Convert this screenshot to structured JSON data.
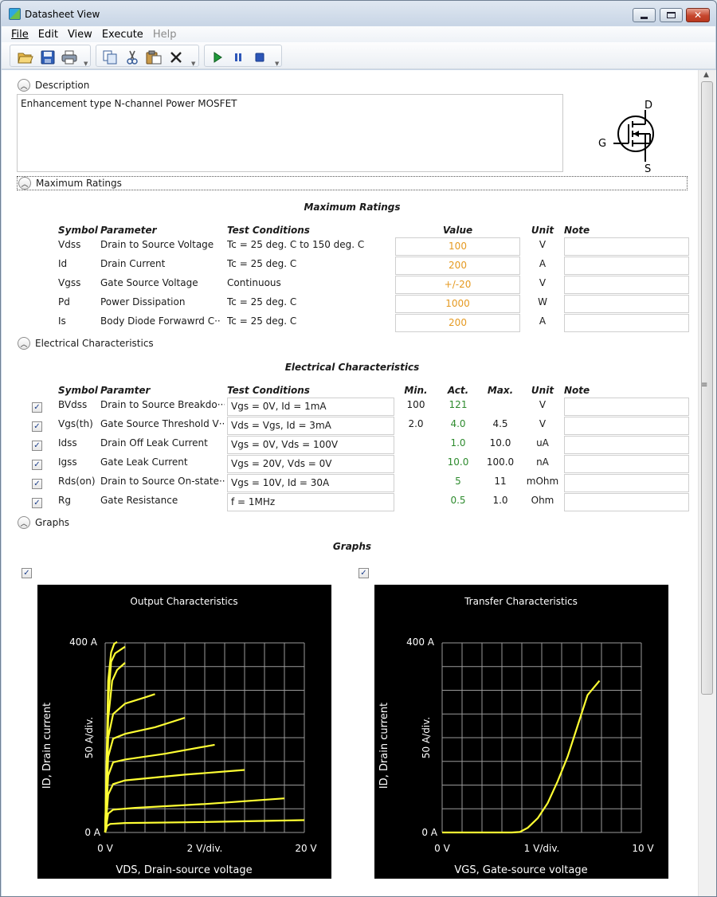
{
  "window": {
    "title": "Datasheet View"
  },
  "menu": {
    "items": [
      "File",
      "Edit",
      "View",
      "Execute",
      "Help"
    ]
  },
  "description": {
    "label": "Description",
    "text": "Enhancement type N-channel Power MOSFET",
    "symbol": {
      "d": "D",
      "g": "G",
      "s": "S"
    }
  },
  "max_ratings": {
    "label": "Maximum Ratings",
    "title": "Maximum Ratings",
    "headers": {
      "symbol": "Symbol",
      "parameter": "Parameter",
      "conditions": "Test Conditions",
      "value": "Value",
      "unit": "Unit",
      "note": "Note"
    },
    "rows": [
      {
        "symbol": "Vdss",
        "parameter": "Drain to Source Voltage",
        "conditions": "Tc = 25 deg. C to 150 deg. C",
        "value": "100",
        "unit": "V",
        "note": ""
      },
      {
        "symbol": "Id",
        "parameter": "Drain Current",
        "conditions": "Tc = 25 deg. C",
        "value": "200",
        "unit": "A",
        "note": ""
      },
      {
        "symbol": "Vgss",
        "parameter": "Gate Source Voltage",
        "conditions": "Continuous",
        "value": "+/-20",
        "unit": "V",
        "note": ""
      },
      {
        "symbol": "Pd",
        "parameter": "Power Dissipation",
        "conditions": "Tc = 25 deg. C",
        "value": "1000",
        "unit": "W",
        "note": ""
      },
      {
        "symbol": "Is",
        "parameter": "Body Diode Forwawrd C···",
        "conditions": "Tc = 25 deg. C",
        "value": "200",
        "unit": "A",
        "note": ""
      }
    ]
  },
  "electrical": {
    "label": "Electrical Characteristics",
    "title": "Electrical Characteristics",
    "headers": {
      "symbol": "Symbol",
      "parameter": "Paramter",
      "conditions": "Test Conditions",
      "min": "Min.",
      "act": "Act.",
      "max": "Max.",
      "unit": "Unit",
      "note": "Note"
    },
    "rows": [
      {
        "checked": true,
        "symbol": "BVdss",
        "parameter": "Drain to Source Breakdo···",
        "conditions": "Vgs = 0V, Id = 1mA",
        "min": "100",
        "act": "121",
        "max": "",
        "unit": "V",
        "note": ""
      },
      {
        "checked": true,
        "symbol": "Vgs(th)",
        "parameter": "Gate Source Threshold V···",
        "conditions": "Vds = Vgs, Id = 3mA",
        "min": "2.0",
        "act": "4.0",
        "max": "4.5",
        "unit": "V",
        "note": ""
      },
      {
        "checked": true,
        "symbol": "Idss",
        "parameter": "Drain Off Leak Current",
        "conditions": "Vgs = 0V, Vds = 100V",
        "min": "",
        "act": "1.0",
        "max": "10.0",
        "unit": "uA",
        "note": ""
      },
      {
        "checked": true,
        "symbol": "Igss",
        "parameter": "Gate Leak Current",
        "conditions": "Vgs = 20V, Vds = 0V",
        "min": "",
        "act": "10.0",
        "max": "100.0",
        "unit": "nA",
        "note": ""
      },
      {
        "checked": true,
        "symbol": "Rds(on)",
        "parameter": "Drain to Source On-state···",
        "conditions": "Vgs = 10V, Id = 30A",
        "min": "",
        "act": "5",
        "max": "11",
        "unit": "mOhm",
        "note": ""
      },
      {
        "checked": true,
        "symbol": "Rg",
        "parameter": "Gate Resistance",
        "conditions": "f = 1MHz",
        "min": "",
        "act": "0.5",
        "max": "1.0",
        "unit": "Ohm",
        "note": ""
      }
    ]
  },
  "graphs": {
    "label": "Graphs",
    "title": "Graphs"
  },
  "chart_data": [
    {
      "type": "line",
      "title": "Output Characteristics",
      "xlabel": "VDS, Drain-source voltage",
      "ylabel": "ID, Drain current",
      "x_ticks": [
        "0 V",
        "2 V/div.",
        "20 V"
      ],
      "y_ticks": [
        "0 A",
        "50 A/div.",
        "400 A"
      ],
      "xlim": [
        0,
        20
      ],
      "ylim": [
        0,
        400
      ],
      "grid": true,
      "line_color": "#ffff33",
      "series": [
        {
          "values": [
            [
              0,
              0
            ],
            [
              0.2,
              14
            ],
            [
              0.5,
              18
            ],
            [
              2,
              20
            ],
            [
              10,
              22
            ],
            [
              20,
              26
            ]
          ]
        },
        {
          "values": [
            [
              0,
              0
            ],
            [
              0.3,
              40
            ],
            [
              0.8,
              48
            ],
            [
              3,
              52
            ],
            [
              10,
              60
            ],
            [
              18,
              72
            ]
          ]
        },
        {
          "values": [
            [
              0,
              0
            ],
            [
              0.3,
              80
            ],
            [
              0.8,
              102
            ],
            [
              2,
              110
            ],
            [
              8,
              122
            ],
            [
              14,
              132
            ]
          ]
        },
        {
          "values": [
            [
              0,
              0
            ],
            [
              0.3,
              120
            ],
            [
              0.8,
              148
            ],
            [
              2,
              154
            ],
            [
              6,
              166
            ],
            [
              11,
              185
            ]
          ]
        },
        {
          "values": [
            [
              0,
              0
            ],
            [
              0.3,
              160
            ],
            [
              0.8,
              198
            ],
            [
              2,
              208
            ],
            [
              5,
              222
            ],
            [
              8,
              242
            ]
          ]
        },
        {
          "values": [
            [
              0,
              0
            ],
            [
              0.3,
              200
            ],
            [
              0.8,
              250
            ],
            [
              2,
              272
            ],
            [
              4,
              285
            ],
            [
              5,
              292
            ]
          ]
        },
        {
          "values": [
            [
              0,
              0
            ],
            [
              0.3,
              240
            ],
            [
              0.7,
              320
            ],
            [
              1.2,
              343
            ],
            [
              2,
              358
            ]
          ]
        },
        {
          "values": [
            [
              0,
              0
            ],
            [
              0.3,
              280
            ],
            [
              0.6,
              360
            ],
            [
              1,
              378
            ],
            [
              2,
              392
            ]
          ]
        },
        {
          "values": [
            [
              0,
              0
            ],
            [
              0.3,
              320
            ],
            [
              0.6,
              380
            ],
            [
              0.9,
              398
            ],
            [
              1.2,
              402
            ]
          ]
        }
      ]
    },
    {
      "type": "line",
      "title": "Transfer Characteristics",
      "xlabel": "VGS, Gate-source voltage",
      "ylabel": "ID, Drain current",
      "x_ticks": [
        "0 V",
        "1 V/div.",
        "10 V"
      ],
      "y_ticks": [
        "0 A",
        "50 A/div.",
        "400 A"
      ],
      "xlim": [
        0,
        10
      ],
      "ylim": [
        0,
        400
      ],
      "grid": true,
      "line_color": "#ffff33",
      "series": [
        {
          "values": [
            [
              0,
              0
            ],
            [
              3.5,
              0
            ],
            [
              3.9,
              1
            ],
            [
              4.3,
              10
            ],
            [
              4.8,
              30
            ],
            [
              5.3,
              62
            ],
            [
              5.8,
              108
            ],
            [
              6.3,
              160
            ],
            [
              6.8,
              225
            ],
            [
              7.3,
              290
            ],
            [
              7.9,
              320
            ]
          ]
        }
      ]
    }
  ]
}
